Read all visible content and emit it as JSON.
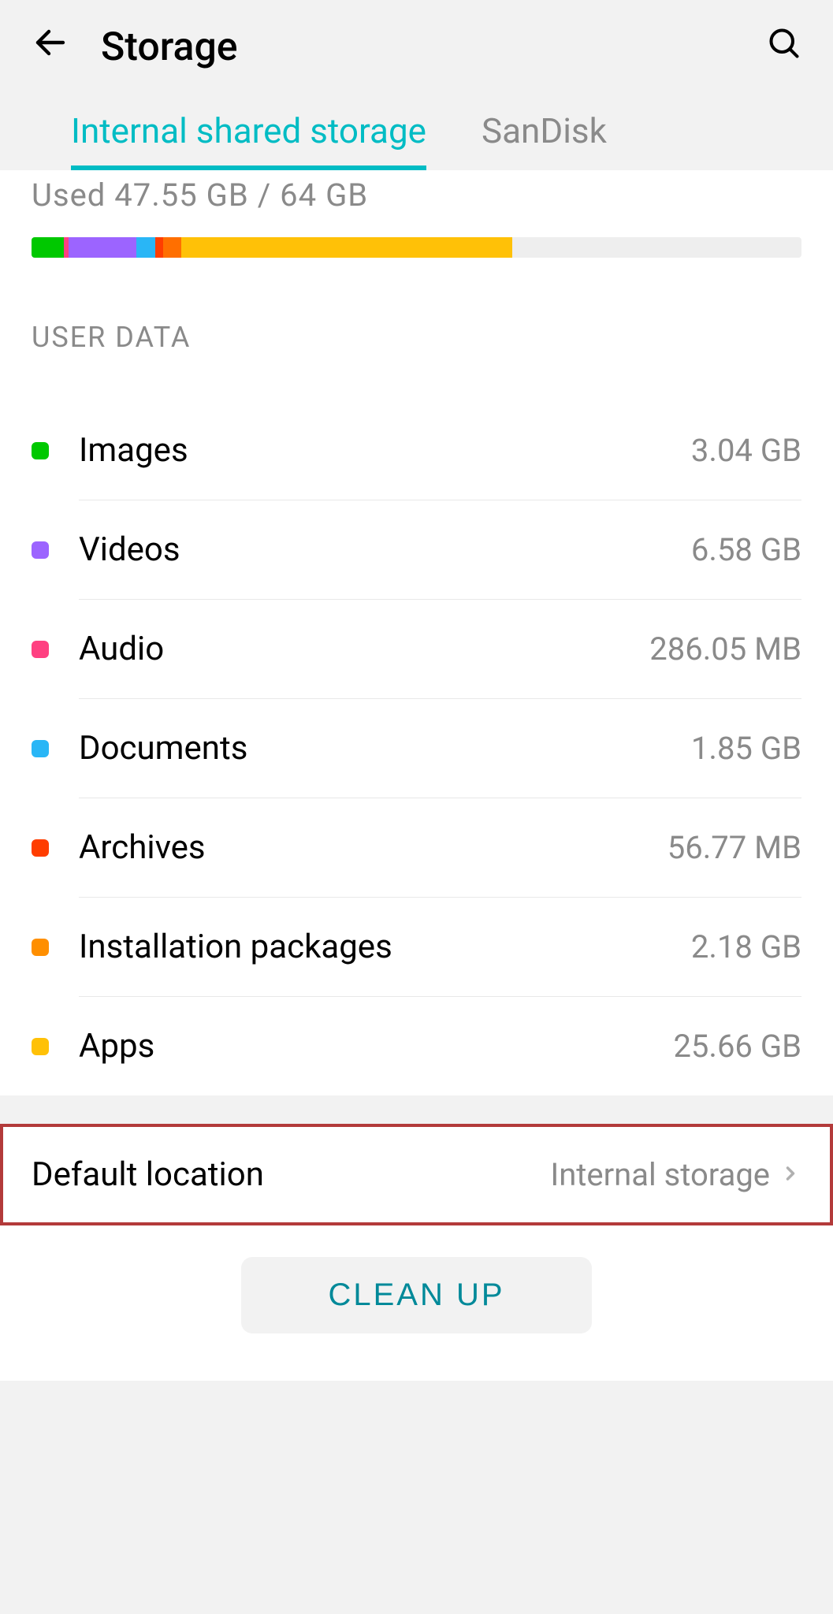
{
  "header": {
    "title": "Storage"
  },
  "tabs": [
    {
      "label": "Internal shared storage",
      "active": true
    },
    {
      "label": "SanDisk",
      "active": false
    }
  ],
  "usage": {
    "text": "Used 47.55 GB / 64 GB"
  },
  "section_header": "USER DATA",
  "categories": [
    {
      "label": "Images",
      "value": "3.04 GB",
      "color": "sw-green"
    },
    {
      "label": "Videos",
      "value": "6.58 GB",
      "color": "sw-purple"
    },
    {
      "label": "Audio",
      "value": "286.05 MB",
      "color": "sw-pink"
    },
    {
      "label": "Documents",
      "value": "1.85 GB",
      "color": "sw-blue"
    },
    {
      "label": "Archives",
      "value": "56.77 MB",
      "color": "sw-red"
    },
    {
      "label": "Installation packages",
      "value": "2.18 GB",
      "color": "sw-orange"
    },
    {
      "label": "Apps",
      "value": "25.66 GB",
      "color": "sw-amber"
    }
  ],
  "default_location": {
    "label": "Default location",
    "value": "Internal storage"
  },
  "clean_button": "CLEAN UP"
}
